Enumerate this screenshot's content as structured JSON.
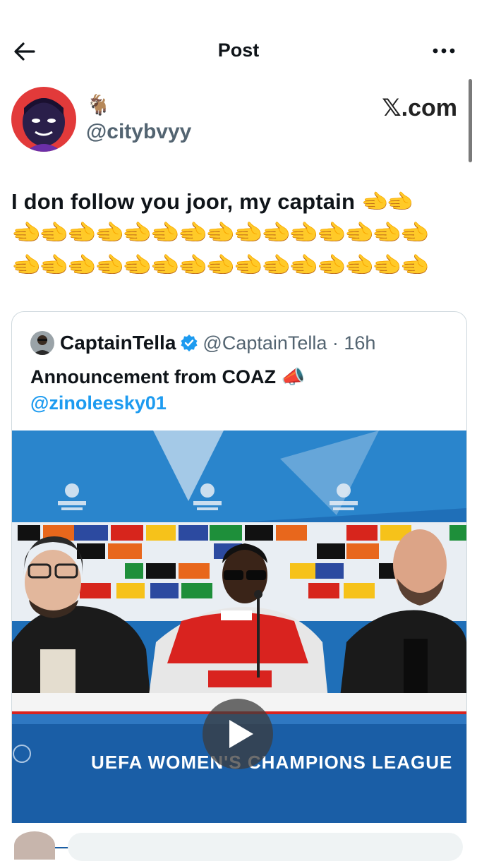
{
  "header": {
    "title": "Post"
  },
  "post": {
    "display_name": "🐐",
    "handle": "@citybvyy",
    "watermark": "𝕏.com",
    "text": "I don follow you joor, my captain",
    "text_trailing_emoji": "🫲🫲",
    "emoji_rows": [
      "🫲🫲🫲🫲🫲🫲🫲🫲🫲🫲🫲🫲🫲🫲🫲",
      "🫲🫲🫲🫲🫲🫲🫲🫲🫲🫲🫲🫲🫲🫲🫲"
    ]
  },
  "quote": {
    "name": "CaptainTella",
    "handle_time": "@CaptainTella · 16h",
    "text": "Announcement from COAZ 📣",
    "mention": "@zinoleesky01",
    "video": {
      "banner_text": "UEFA WOMEN'S CHAMPIONS LEAGUE"
    }
  },
  "colors": {
    "accent": "#1d9bf0",
    "secondary_text": "#536471",
    "border": "#cfd9de"
  }
}
